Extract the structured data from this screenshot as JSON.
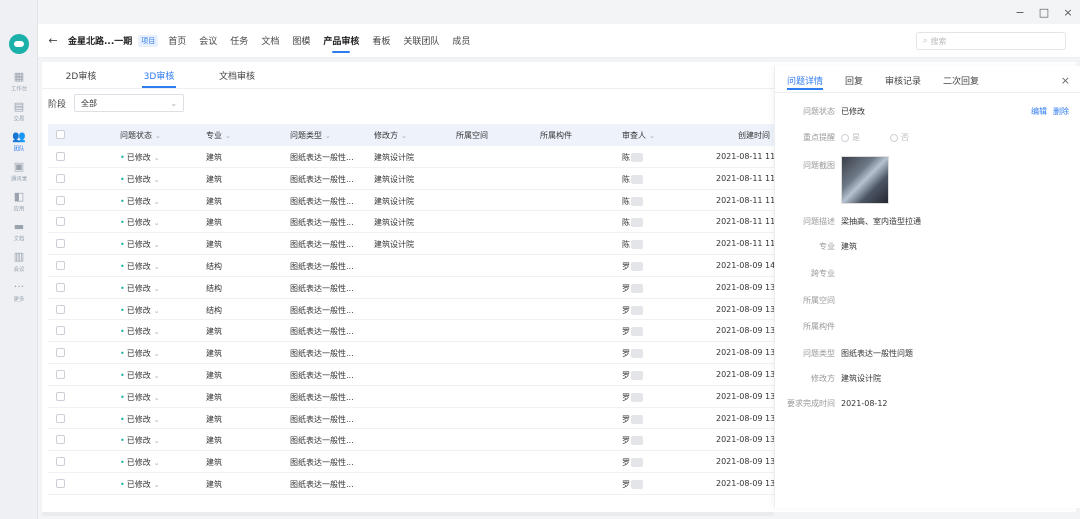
{
  "window": {
    "minimize": "−",
    "maximize": "□",
    "close": "×"
  },
  "rail": {
    "items": [
      {
        "label": "工作台",
        "icon": "dashboard-icon",
        "glyph": "▦"
      },
      {
        "label": "交易",
        "icon": "chat-icon",
        "glyph": "▤"
      },
      {
        "label": "团队",
        "icon": "team-icon",
        "glyph": "👥",
        "active": true
      },
      {
        "label": "通讯录",
        "icon": "contacts-icon",
        "glyph": "▣"
      },
      {
        "label": "应用",
        "icon": "apps-icon",
        "glyph": "◧"
      },
      {
        "label": "文档",
        "icon": "folder-icon",
        "glyph": "▬"
      },
      {
        "label": "会议",
        "icon": "meeting-icon",
        "glyph": "▥"
      },
      {
        "label": "更多",
        "icon": "more-icon",
        "glyph": "···"
      }
    ]
  },
  "topbar": {
    "back": "←",
    "project_title": "金星北路...一期",
    "project_tag": "项目",
    "tabs": [
      "首页",
      "会议",
      "任务",
      "文档",
      "图模",
      "产品审核",
      "看板",
      "关联团队",
      "成员"
    ],
    "active_tab": "产品审核",
    "search_placeholder": "搜索"
  },
  "subtabs": {
    "items": [
      "2D审核",
      "3D审核",
      "文档审核"
    ],
    "active": "3D审核"
  },
  "filter": {
    "label": "阶段",
    "value": "全部"
  },
  "table": {
    "headers": {
      "status": "问题状态",
      "major": "专业",
      "type": "问题类型",
      "fix_by": "修改方",
      "space": "所属空间",
      "component": "所属构件",
      "reviewer": "审查人",
      "created": "创建时间"
    },
    "rows": [
      {
        "status": "已修改",
        "major": "建筑",
        "type": "图纸表达一般性...",
        "fix_by": "建筑设计院",
        "reviewer": "陈",
        "created": "2021-08-11 11:"
      },
      {
        "status": "已修改",
        "major": "建筑",
        "type": "图纸表达一般性...",
        "fix_by": "建筑设计院",
        "reviewer": "陈",
        "created": "2021-08-11 11:"
      },
      {
        "status": "已修改",
        "major": "建筑",
        "type": "图纸表达一般性...",
        "fix_by": "建筑设计院",
        "reviewer": "陈",
        "created": "2021-08-11 11:"
      },
      {
        "status": "已修改",
        "major": "建筑",
        "type": "图纸表达一般性...",
        "fix_by": "建筑设计院",
        "reviewer": "陈",
        "created": "2021-08-11 11:"
      },
      {
        "status": "已修改",
        "major": "建筑",
        "type": "图纸表达一般性...",
        "fix_by": "建筑设计院",
        "reviewer": "陈",
        "created": "2021-08-11 11:"
      },
      {
        "status": "已修改",
        "major": "结构",
        "type": "图纸表达一般性...",
        "fix_by": "",
        "reviewer": "罗",
        "created": "2021-08-09 14:"
      },
      {
        "status": "已修改",
        "major": "结构",
        "type": "图纸表达一般性...",
        "fix_by": "",
        "reviewer": "罗",
        "created": "2021-08-09 13:"
      },
      {
        "status": "已修改",
        "major": "结构",
        "type": "图纸表达一般性...",
        "fix_by": "",
        "reviewer": "罗",
        "created": "2021-08-09 13:"
      },
      {
        "status": "已修改",
        "major": "建筑",
        "type": "图纸表达一般性...",
        "fix_by": "",
        "reviewer": "罗",
        "created": "2021-08-09 13:"
      },
      {
        "status": "已修改",
        "major": "建筑",
        "type": "图纸表达一般性...",
        "fix_by": "",
        "reviewer": "罗",
        "created": "2021-08-09 13:"
      },
      {
        "status": "已修改",
        "major": "建筑",
        "type": "图纸表达一般性...",
        "fix_by": "",
        "reviewer": "罗",
        "created": "2021-08-09 13:"
      },
      {
        "status": "已修改",
        "major": "建筑",
        "type": "图纸表达一般性...",
        "fix_by": "",
        "reviewer": "罗",
        "created": "2021-08-09 13:"
      },
      {
        "status": "已修改",
        "major": "建筑",
        "type": "图纸表达一般性...",
        "fix_by": "",
        "reviewer": "罗",
        "created": "2021-08-09 13:"
      },
      {
        "status": "已修改",
        "major": "建筑",
        "type": "图纸表达一般性...",
        "fix_by": "",
        "reviewer": "罗",
        "created": "2021-08-09 13:"
      },
      {
        "status": "已修改",
        "major": "建筑",
        "type": "图纸表达一般性...",
        "fix_by": "",
        "reviewer": "罗",
        "created": "2021-08-09 13:"
      },
      {
        "status": "已修改",
        "major": "建筑",
        "type": "图纸表达一般性...",
        "fix_by": "",
        "reviewer": "罗",
        "created": "2021-08-09 13:"
      }
    ]
  },
  "panel": {
    "tabs": [
      "问题详情",
      "回复",
      "审核记录",
      "二次回复"
    ],
    "active_tab": "问题详情",
    "close": "×",
    "actions": {
      "edit": "编辑",
      "delete": "删除"
    },
    "fields": {
      "status_label": "问题状态",
      "status_value": "已修改",
      "priority_label": "重点提醒",
      "priority_yes": "是",
      "priority_no": "否",
      "screenshot_label": "问题截图",
      "desc_label": "问题描述",
      "desc_value": "梁抽高、室内造型拉通",
      "major_label": "专业",
      "major_value": "建筑",
      "cross_label": "跨专业",
      "cross_value": "",
      "space_label": "所属空间",
      "space_value": "",
      "component_label": "所属构件",
      "component_value": "",
      "type_label": "问题类型",
      "type_value": "图纸表达一般性问题",
      "fix_label": "修改方",
      "fix_value": "建筑设计院",
      "due_label": "要求完成时间",
      "due_value": "2021-08-12"
    }
  }
}
